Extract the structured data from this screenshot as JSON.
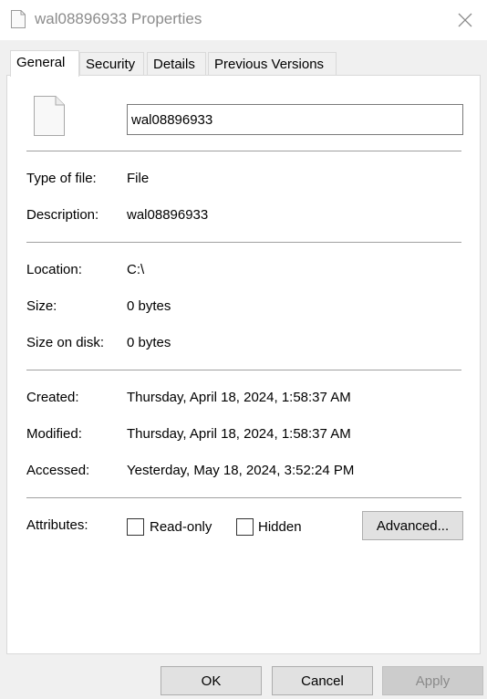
{
  "window": {
    "title": "wal08896933 Properties",
    "title_icon": "blank-file-icon",
    "close_icon": "close-icon"
  },
  "tabs": [
    {
      "label": "General",
      "active": true
    },
    {
      "label": "Security",
      "active": false
    },
    {
      "label": "Details",
      "active": false
    },
    {
      "label": "Previous Versions",
      "active": false
    }
  ],
  "general": {
    "file_icon": "blank-file-icon",
    "file_name": "wal08896933",
    "type_label": "Type of file:",
    "type_value": "File",
    "description_label": "Description:",
    "description_value": "wal08896933",
    "location_label": "Location:",
    "location_value": "C:\\",
    "size_label": "Size:",
    "size_value": "0 bytes",
    "size_on_disk_label": "Size on disk:",
    "size_on_disk_value": "0 bytes",
    "created_label": "Created:",
    "created_value": "Thursday, April 18, 2024, 1:58:37 AM",
    "modified_label": "Modified:",
    "modified_value": "Thursday, April 18, 2024, 1:58:37 AM",
    "accessed_label": "Accessed:",
    "accessed_value": "Yesterday, May 18, 2024, 3:52:24 PM",
    "attributes_label": "Attributes:",
    "readonly_label": "Read-only",
    "readonly_checked": false,
    "hidden_label": "Hidden",
    "hidden_checked": false,
    "advanced_label": "Advanced..."
  },
  "footer": {
    "ok_label": "OK",
    "cancel_label": "Cancel",
    "apply_label": "Apply",
    "apply_enabled": false
  },
  "colors": {
    "window_bg": "#f0f0f0",
    "panel_bg": "#ffffff",
    "title_text": "#8c8c8c",
    "separator": "#a0a0a0",
    "button_bg": "#e1e1e1",
    "button_disabled_bg": "#cccccc"
  }
}
